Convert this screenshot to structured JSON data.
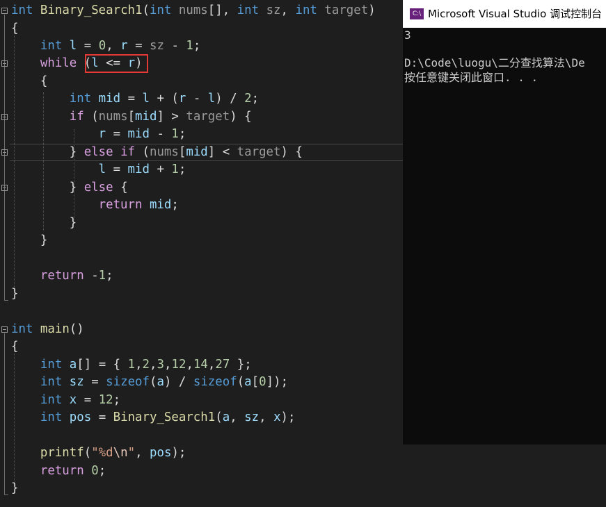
{
  "editor": {
    "lines": [
      [
        "",
        "int",
        " ",
        "Binary_Search1",
        "(",
        "int",
        " ",
        "nums",
        "[], ",
        "int",
        " ",
        "sz",
        ", ",
        "int",
        " ",
        "target",
        ")"
      ],
      [
        "{"
      ],
      [
        "    ",
        "int",
        " ",
        "l",
        " = ",
        "0",
        ", ",
        "r",
        " = ",
        "sz",
        " - ",
        "1",
        ";"
      ],
      [
        "    ",
        "while",
        " ",
        "(",
        "l",
        " <= ",
        "r",
        ")"
      ],
      [
        "    {"
      ],
      [
        "        ",
        "int",
        " ",
        "mid",
        " = ",
        "l",
        " + (",
        "r",
        " - ",
        "l",
        ") / ",
        "2",
        ";"
      ],
      [
        "        ",
        "if",
        " (",
        "nums",
        "[",
        "mid",
        "] > ",
        "target",
        ") {"
      ],
      [
        "            ",
        "r",
        " = ",
        "mid",
        " - ",
        "1",
        ";"
      ],
      [
        "        } ",
        "else",
        " ",
        "if",
        " (",
        "nums",
        "[",
        "mid",
        "] < ",
        "target",
        ") {"
      ],
      [
        "            ",
        "l",
        " = ",
        "mid",
        " + ",
        "1",
        ";"
      ],
      [
        "        } ",
        "else",
        " {"
      ],
      [
        "            ",
        "return",
        " ",
        "mid",
        ";"
      ],
      [
        "        }"
      ],
      [
        "    }"
      ],
      [
        ""
      ],
      [
        "    ",
        "return",
        " -",
        "1",
        ";"
      ],
      [
        "}"
      ],
      [
        ""
      ],
      [
        "",
        "int",
        " ",
        "main",
        "()"
      ],
      [
        "{"
      ],
      [
        "    ",
        "int",
        " ",
        "a",
        "[] = { ",
        "1",
        ",",
        "2",
        ",",
        "3",
        ",",
        "12",
        ",",
        "14",
        ",",
        "27",
        " };"
      ],
      [
        "    ",
        "int",
        " ",
        "sz",
        " = ",
        "sizeof",
        "(",
        "a",
        ") / ",
        "sizeof",
        "(",
        "a",
        "[",
        "0",
        "]);"
      ],
      [
        "    ",
        "int",
        " ",
        "x",
        " = ",
        "12",
        ";"
      ],
      [
        "    ",
        "int",
        " ",
        "pos",
        " = ",
        "Binary_Search1",
        "(",
        "a",
        ", ",
        "sz",
        ", ",
        "x",
        ");"
      ],
      [
        ""
      ],
      [
        "    ",
        "printf",
        "(",
        "\"%d",
        "\\n",
        "\"",
        ", ",
        "pos",
        ");"
      ],
      [
        "    ",
        "return",
        " ",
        "0",
        ";"
      ],
      [
        "}"
      ]
    ],
    "highlight": "(l <= r)"
  },
  "console": {
    "title": "Microsoft Visual Studio 调试控制台",
    "icon_label": "C:\\",
    "output": [
      "3",
      "",
      "D:\\Code\\luogu\\二分查找算法\\De",
      "按任意键关闭此窗口. . ."
    ]
  },
  "colors": {
    "background": "#1e1e1e",
    "keyword": "#569cd6",
    "control_keyword": "#d8a0df",
    "function": "#dcdcaa",
    "number": "#b5cea8",
    "parameter": "#9a9a9a",
    "variable": "#9cdcfe",
    "string": "#d69d85",
    "highlight_box": "#e53935"
  }
}
